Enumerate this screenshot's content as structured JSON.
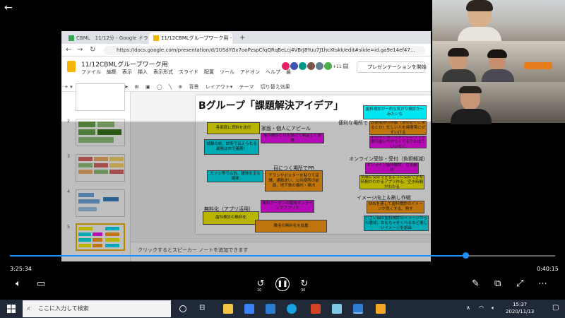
{
  "player": {
    "time_elapsed": "3:25:34",
    "time_remaining": "0:40:15",
    "progress": 0.835,
    "skip_back": "10",
    "skip_forward": "30"
  },
  "browser": {
    "tabs": [
      {
        "label": "CBML　11/12分 - Google ドライブ",
        "active": false
      },
      {
        "label": "11/12CBMLグループワーク用 - Goo",
        "active": true
      }
    ],
    "new_tab": "+",
    "url": "https://docs.google.com/presentation/d/1USdYGx7ooPzspCfqQRqBeLcj4VBrJ8Yuu7J1hcXtskk/edit#slide=id.ga9e14ef47..."
  },
  "slides_app": {
    "doc_title": "11/12CBMLグループワーク用",
    "menu": [
      "ファイル",
      "編集",
      "表示",
      "挿入",
      "表示形式",
      "スライド",
      "配置",
      "ツール",
      "アドオン",
      "ヘルプ",
      "最"
    ],
    "collab_count": "+11",
    "present_label": "プレゼンテーションを開始",
    "toolbar": [
      "背景",
      "レイアウト▾",
      "テーマ",
      "切り替え効果"
    ],
    "notes_placeholder": "クリックするとスピーカー ノートを追加できます",
    "thumb_numbers": [
      "2",
      "3",
      "4",
      "5"
    ]
  },
  "slide": {
    "title": "Bグループ「課題解決アイデア」",
    "section_labels": {
      "family": "家庭・個人にアピール",
      "convenient": "便利な場所で",
      "public": "目につく場所でPR",
      "online": "オンライン受診・受付（負担軽減）",
      "free": "無料化（アプリ活用）",
      "image": "イメージ向上＆刷し作戦"
    },
    "notes": [
      {
        "id": "n1",
        "text": "各家庭に資料を送付",
        "color": "y"
      },
      {
        "id": "n2",
        "text": "歯科検診の月を設けて制定して実施",
        "color": "m"
      },
      {
        "id": "n3",
        "text": "試験の前、診断で伝えられる最後は市で義務！",
        "color": "c"
      },
      {
        "id": "n4",
        "text": "カフェ等で広告、雑誌を主な媒体",
        "color": "c"
      },
      {
        "id": "n5",
        "text": "チラシやポスターを貼りて店舗、通勤途い、公共便所の前面、地下鉄の構内・車内",
        "color": "o"
      },
      {
        "id": "n6",
        "text": "無料クーポンの配布オンラインでアプリで",
        "color": "m"
      },
      {
        "id": "n7",
        "text": "歯科検診の無料化",
        "color": "y"
      },
      {
        "id": "n8",
        "text": "費用の無料化を拡散",
        "color": "o"
      },
      {
        "id": "n9",
        "text": "歯科検診が一的な気がり検診か～みたいな",
        "color": "c"
      },
      {
        "id": "n10",
        "text": "診療場所の移動（身の近くに来るとか）忙しい人を時間帯にせずいける",
        "color": "o"
      },
      {
        "id": "n11",
        "text": "駅前など通りの多いところで移動可能いやがらくてもでお出ていいなど",
        "color": "m"
      },
      {
        "id": "n12",
        "text": "オンライン歯科検診、住宅健診",
        "color": "m"
      },
      {
        "id": "n13",
        "text": "気軽に受診できるように受診できる時間がわかるアプリ作る、空き時間がわかる",
        "color": "y"
      },
      {
        "id": "n14",
        "text": "SNSを通して歯科検診のイメージが良くする、発す",
        "color": "o"
      },
      {
        "id": "n15",
        "text": "小さい頃の歯科検診のイメージからの脱却、おもちゃをくれるなど楽しいイメージを創出",
        "color": "c"
      }
    ]
  },
  "taskbar": {
    "search_placeholder": "ここに入力して検索",
    "time": "15:37",
    "date": "2020/11/13"
  },
  "colors": {
    "y": "#f7f000",
    "m": "#f20ef2",
    "c": "#00e5f2",
    "o": "#ff9d10",
    "accent": "#1e90ff"
  }
}
